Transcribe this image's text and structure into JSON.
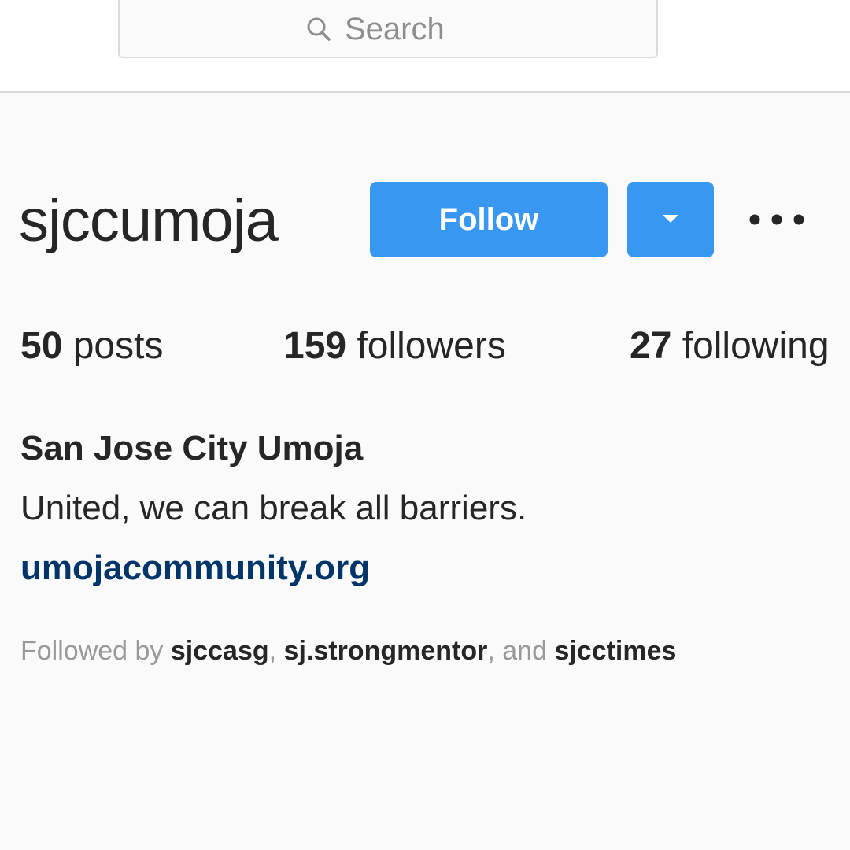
{
  "search": {
    "placeholder": "Search"
  },
  "profile": {
    "username": "sjccumoja",
    "follow_label": "Follow",
    "full_name": "San Jose City Umoja",
    "bio": "United, we can break all barriers.",
    "website": "umojacommunity.org"
  },
  "stats": {
    "posts_count": "50",
    "posts_label": "posts",
    "followers_count": "159",
    "followers_label": "followers",
    "following_count": "27",
    "following_label": "following"
  },
  "followed_by": {
    "prefix": "Followed by",
    "users": [
      "sjccasg",
      "sj.strongmentor",
      "sjcctimes"
    ],
    "sep1": ", ",
    "sep2": ", and "
  },
  "icons": {
    "search": "search-icon",
    "dropdown": "caret-down-icon",
    "more": "more-horizontal-icon"
  },
  "colors": {
    "accent": "#3897f0",
    "link": "#003569",
    "text": "#262626",
    "muted": "#999999"
  }
}
